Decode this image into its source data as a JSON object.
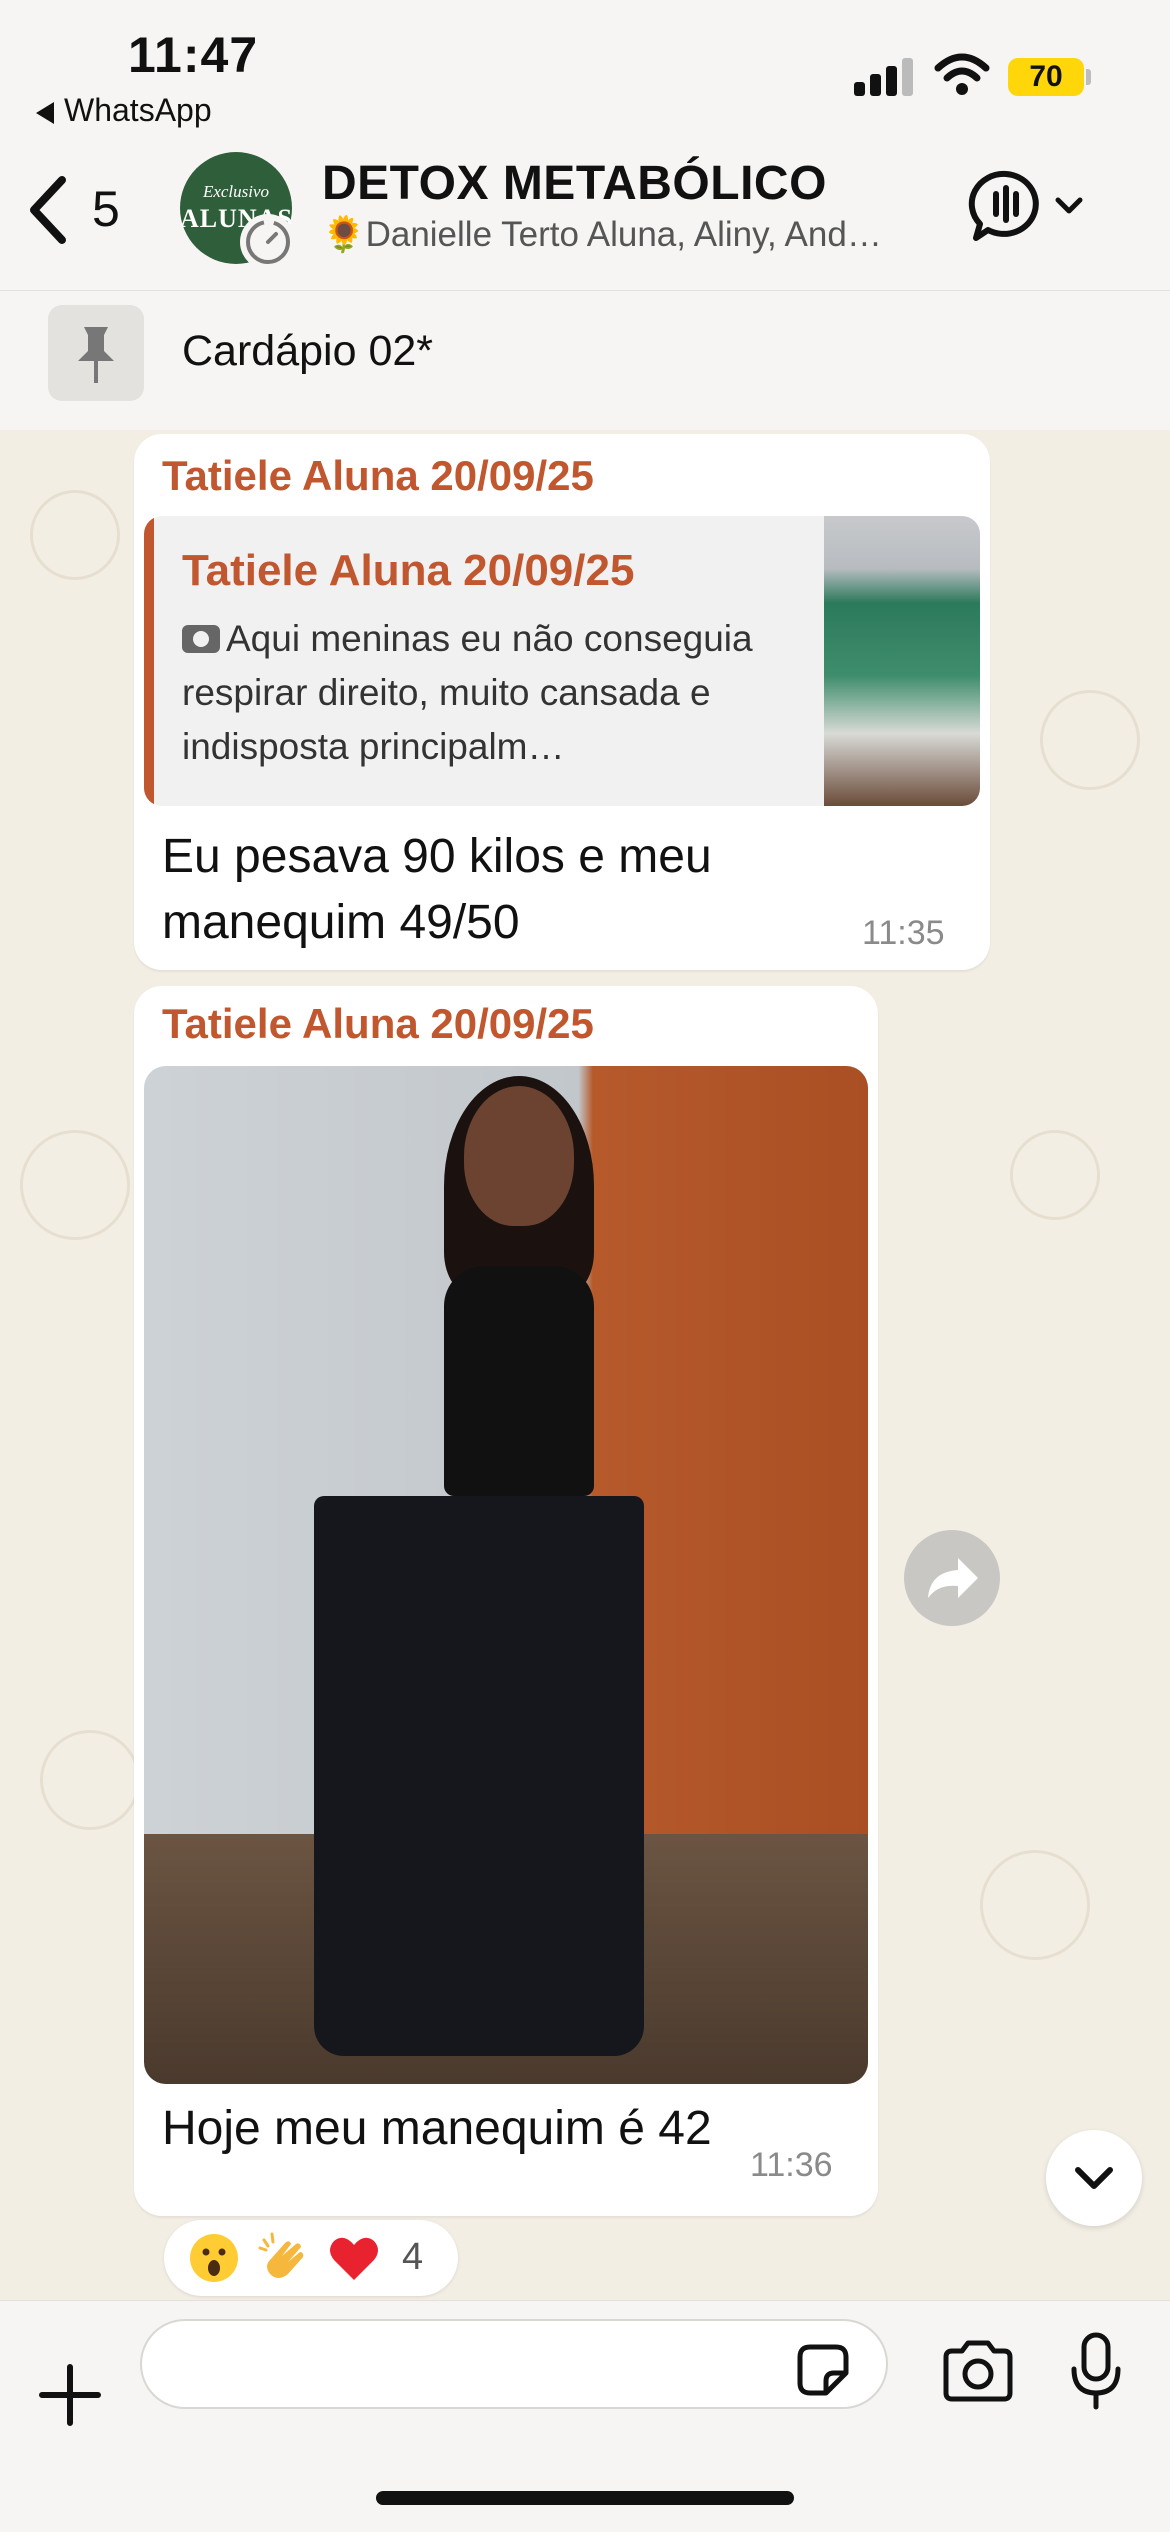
{
  "status_bar": {
    "time": "11:47",
    "back_app": "WhatsApp",
    "battery": "70"
  },
  "header": {
    "back_count": "5",
    "avatar_line1": "Exclusivo",
    "avatar_line2": "ALUNAS",
    "group_name": "DETOX METABÓLICO",
    "members": "🌻Danielle Terto Aluna, Aliny, And…"
  },
  "pinned": {
    "title": "Cardápio 02*"
  },
  "messages": [
    {
      "sender": "Tatiele Aluna 20/09/25",
      "quote": {
        "sender": "Tatiele Aluna 20/09/25",
        "text": "Aqui meninas eu não conseguia respirar direito, muito cansada e indisposta principalm…"
      },
      "text": "Eu pesava 90 kilos e meu manequim 49/50",
      "time": "11:35"
    },
    {
      "sender": "Tatiele Aluna 20/09/25",
      "text": "Hoje meu manequim é 42",
      "time": "11:36",
      "reactions": {
        "emojis": [
          "😮",
          "👏",
          "❤️"
        ],
        "count": "4"
      }
    }
  ],
  "colors": {
    "sender": "#c0572f",
    "background": "#f3eee4",
    "battery": "#ffd60a"
  },
  "icons": [
    "back-chevron-icon",
    "pin-icon",
    "voice-chat-icon",
    "chevron-down-icon",
    "camera-icon",
    "forward-icon",
    "plus-icon",
    "sticker-icon",
    "mic-icon",
    "wifi-icon",
    "signal-icon"
  ]
}
